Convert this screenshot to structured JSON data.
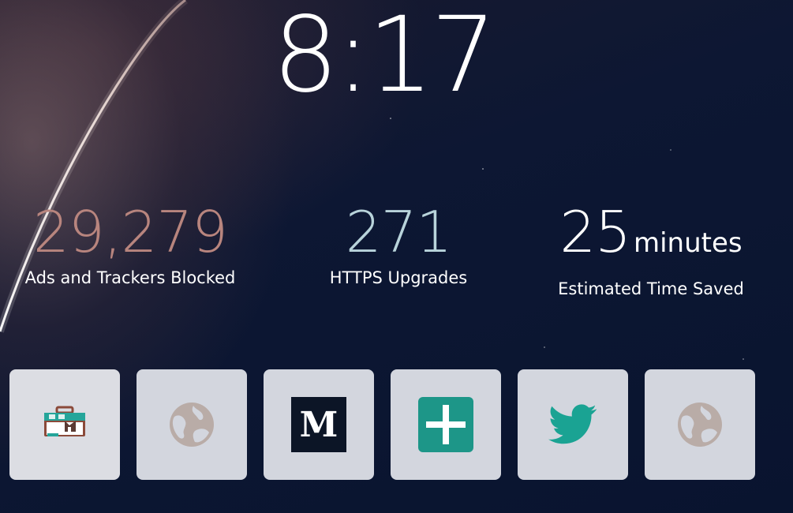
{
  "clock": {
    "time": "8:17"
  },
  "stats": {
    "ads": {
      "value": "29,279",
      "label": "Ads and Trackers Blocked",
      "color": "#b8857e"
    },
    "https": {
      "value": "271",
      "label": "HTTPS Upgrades",
      "color": "#b8d3da"
    },
    "time": {
      "value": "25",
      "unit": "minutes",
      "label": "Estimated Time Saved",
      "color": "#ffffff"
    }
  },
  "top_sites": [
    {
      "icon": "toolbox-icon"
    },
    {
      "icon": "globe-icon"
    },
    {
      "icon": "medium-logo-icon"
    },
    {
      "icon": "plus-icon"
    },
    {
      "icon": "twitter-bird-icon"
    },
    {
      "icon": "globe-icon"
    }
  ]
}
